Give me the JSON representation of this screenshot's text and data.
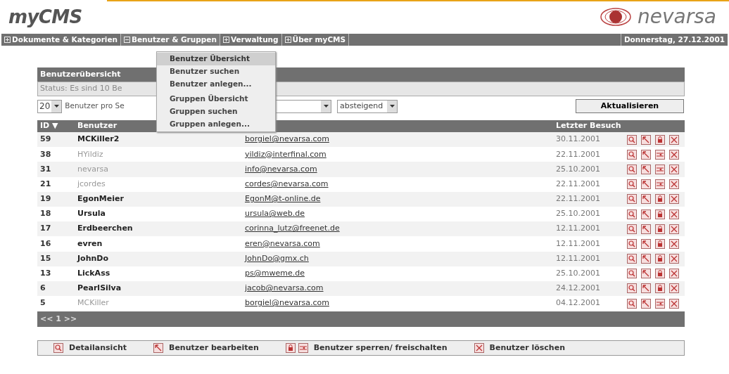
{
  "header": {
    "logo": "myCMS",
    "brand": "nevarsa"
  },
  "nav": [
    {
      "label": "Dokumente & Kategorien",
      "expanded": false
    },
    {
      "label": "Benutzer & Gruppen",
      "expanded": true
    },
    {
      "label": "Verwaltung",
      "expanded": false
    },
    {
      "label": "Über myCMS",
      "expanded": false
    }
  ],
  "date": "Donnerstag, 27.12.2001",
  "menu": [
    {
      "label": "Benutzer Übersicht",
      "selected": true
    },
    {
      "label": "Benutzer suchen",
      "selected": false
    },
    {
      "label": "Benutzer anlegen...",
      "selected": false
    },
    {
      "label": "Gruppen Übersicht",
      "selected": false
    },
    {
      "label": "Gruppen suchen",
      "selected": false
    },
    {
      "label": "Gruppen anlegen...",
      "selected": false
    }
  ],
  "panel": {
    "title": "Benutzerübersicht",
    "status": "Status: Es sind 10 Be",
    "per_page": "20",
    "per_page_label": "Benutzer pro Se",
    "order": "absteigend",
    "refresh": "Aktualisieren"
  },
  "table": {
    "columns": [
      "ID ▼",
      "Benutzer",
      "Letzter Besuch"
    ],
    "rows": [
      {
        "id": "59",
        "user": "MCKiller2",
        "email": "borgiel@nevarsa.com",
        "last_visit": "30.11.2001",
        "active": true
      },
      {
        "id": "38",
        "user": "HYildiz",
        "email": "yildiz@interfinal.com",
        "last_visit": "22.11.2001",
        "active": false
      },
      {
        "id": "31",
        "user": "nevarsa",
        "email": "info@nevarsa.com",
        "last_visit": "25.10.2001",
        "active": false
      },
      {
        "id": "21",
        "user": "jcordes",
        "email": "cordes@nevarsa.com",
        "last_visit": "22.11.2001",
        "active": false
      },
      {
        "id": "19",
        "user": "EgonMeier",
        "email": "EgonM@t-online.de",
        "last_visit": "22.11.2001",
        "active": true
      },
      {
        "id": "18",
        "user": "Ursula",
        "email": "ursula@web.de",
        "last_visit": "25.10.2001",
        "active": true
      },
      {
        "id": "17",
        "user": "Erdbeerchen",
        "email": "corinna_lutz@freenet.de",
        "last_visit": "12.11.2001",
        "active": true
      },
      {
        "id": "16",
        "user": "evren",
        "email": "eren@nevarsa.com",
        "last_visit": "12.11.2001",
        "active": true
      },
      {
        "id": "15",
        "user": "JohnDo",
        "email": "JohnDo@gmx.ch",
        "last_visit": "12.11.2001",
        "active": true
      },
      {
        "id": "13",
        "user": "LickAss",
        "email": "ps@mweme.de",
        "last_visit": "25.10.2001",
        "active": true
      },
      {
        "id": "6",
        "user": "PearlSilva",
        "email": "jacob@nevarsa.com",
        "last_visit": "24.12.2001",
        "active": true
      },
      {
        "id": "5",
        "user": "MCKiller",
        "email": "borgiel@nevarsa.com",
        "last_visit": "04.12.2001",
        "active": false
      }
    ]
  },
  "pager": "<< 1 >>",
  "legend": [
    {
      "kind": "detail",
      "label": "Detailansicht"
    },
    {
      "kind": "edit",
      "label": "Benutzer bearbeiten"
    },
    {
      "kind": "lock",
      "label": "Benutzer sperren/ freischalten"
    },
    {
      "kind": "delete",
      "label": "Benutzer löschen"
    }
  ]
}
